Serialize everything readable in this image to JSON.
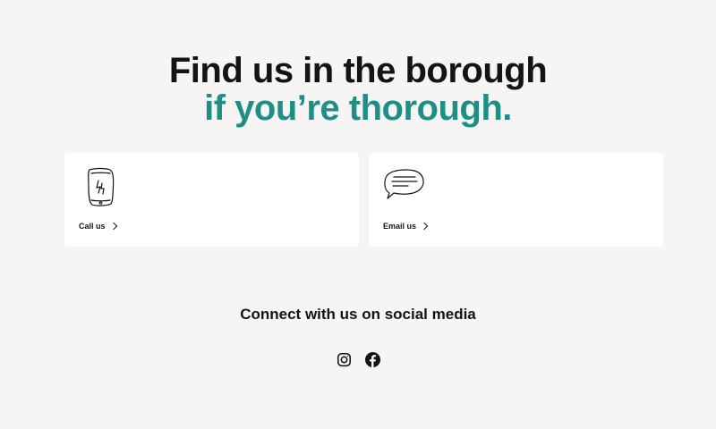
{
  "headline": {
    "line1": "Find us in the borough",
    "line2": "if you’re thorough.",
    "accent_color": "#1f8f86"
  },
  "contact_cards": [
    {
      "icon": "phone-icon",
      "label": "Call us"
    },
    {
      "icon": "speech-bubble-icon",
      "label": "Email us"
    }
  ],
  "social": {
    "title": "Connect with us on social media",
    "icons": [
      "instagram-icon",
      "facebook-icon"
    ]
  }
}
